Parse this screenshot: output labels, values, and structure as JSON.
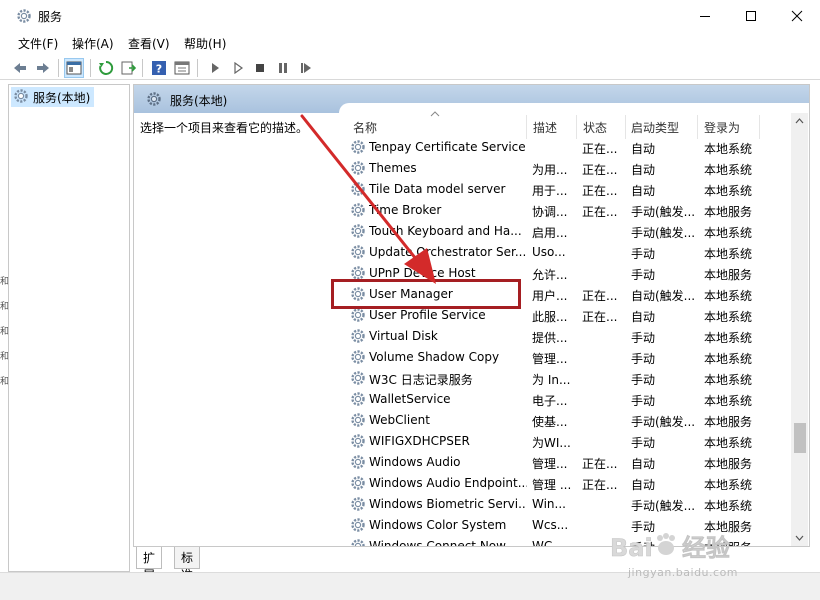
{
  "window": {
    "title": "服务"
  },
  "menu": [
    "文件(F)",
    "操作(A)",
    "查看(V)",
    "帮助(H)"
  ],
  "toolbar": {
    "icons": [
      "back-icon",
      "forward-icon",
      "show-console-tree-icon",
      "refresh-icon",
      "export-list-icon",
      "help-icon",
      "properties-icon",
      "start-service-icon",
      "start-service-alt-icon",
      "stop-service-icon",
      "pause-service-icon",
      "restart-service-icon"
    ]
  },
  "tree": {
    "root_label": "服务(本地)"
  },
  "main": {
    "header_label": "服务(本地)",
    "description": "选择一个项目来查看它的描述。"
  },
  "columns": {
    "name": "名称",
    "description": "描述",
    "status": "状态",
    "startup": "启动类型",
    "logon": "登录为"
  },
  "services": [
    {
      "name": "Tenpay Certificate Service",
      "description": "",
      "status": "正在...",
      "startup": "自动",
      "logon": "本地系统"
    },
    {
      "name": "Themes",
      "description": "为用...",
      "status": "正在...",
      "startup": "自动",
      "logon": "本地系统"
    },
    {
      "name": "Tile Data model server",
      "description": "用于...",
      "status": "正在...",
      "startup": "自动",
      "logon": "本地系统"
    },
    {
      "name": "Time Broker",
      "description": "协调...",
      "status": "正在...",
      "startup": "手动(触发...",
      "logon": "本地服务"
    },
    {
      "name": "Touch Keyboard and Ha...",
      "description": "启用...",
      "status": "",
      "startup": "手动(触发...",
      "logon": "本地系统"
    },
    {
      "name": "Update Orchestrator Ser...",
      "description": "Uso...",
      "status": "",
      "startup": "手动",
      "logon": "本地系统"
    },
    {
      "name": "UPnP Device Host",
      "description": "允许...",
      "status": "",
      "startup": "手动",
      "logon": "本地服务"
    },
    {
      "name": "User Manager",
      "description": "用户...",
      "status": "正在...",
      "startup": "自动(触发...",
      "logon": "本地系统"
    },
    {
      "name": "User Profile Service",
      "description": "此服...",
      "status": "正在...",
      "startup": "自动",
      "logon": "本地系统"
    },
    {
      "name": "Virtual Disk",
      "description": "提供...",
      "status": "",
      "startup": "手动",
      "logon": "本地系统"
    },
    {
      "name": "Volume Shadow Copy",
      "description": "管理...",
      "status": "",
      "startup": "手动",
      "logon": "本地系统"
    },
    {
      "name": "W3C 日志记录服务",
      "description": "为 In...",
      "status": "",
      "startup": "手动",
      "logon": "本地系统"
    },
    {
      "name": "WalletService",
      "description": "电子...",
      "status": "",
      "startup": "手动",
      "logon": "本地系统"
    },
    {
      "name": "WebClient",
      "description": "使基...",
      "status": "",
      "startup": "手动(触发...",
      "logon": "本地服务"
    },
    {
      "name": "WIFIGXDHCPSER",
      "description": "为WI...",
      "status": "",
      "startup": "手动",
      "logon": "本地系统"
    },
    {
      "name": "Windows Audio",
      "description": "管理...",
      "status": "正在...",
      "startup": "自动",
      "logon": "本地服务"
    },
    {
      "name": "Windows Audio Endpoint...",
      "description": "管理 ...",
      "status": "正在...",
      "startup": "自动",
      "logon": "本地系统"
    },
    {
      "name": "Windows Biometric Servi...",
      "description": "Win...",
      "status": "",
      "startup": "手动(触发...",
      "logon": "本地系统"
    },
    {
      "name": "Windows Color System",
      "description": "Wcs...",
      "status": "",
      "startup": "手动",
      "logon": "本地服务"
    },
    {
      "name": "Windows Connect Now",
      "description": "WC...",
      "status": "",
      "startup": "手动",
      "logon": "本地服务"
    }
  ],
  "tabs": [
    "扩展",
    "标准"
  ],
  "watermark": {
    "brand": "Baidu经验",
    "site": "jingyan.baidu.com"
  },
  "colors": {
    "highlight_border": "#a51e22",
    "arrow": "#d32a2a",
    "header_bg": "#b5cbe4",
    "tree_selection": "#cde8ff"
  }
}
